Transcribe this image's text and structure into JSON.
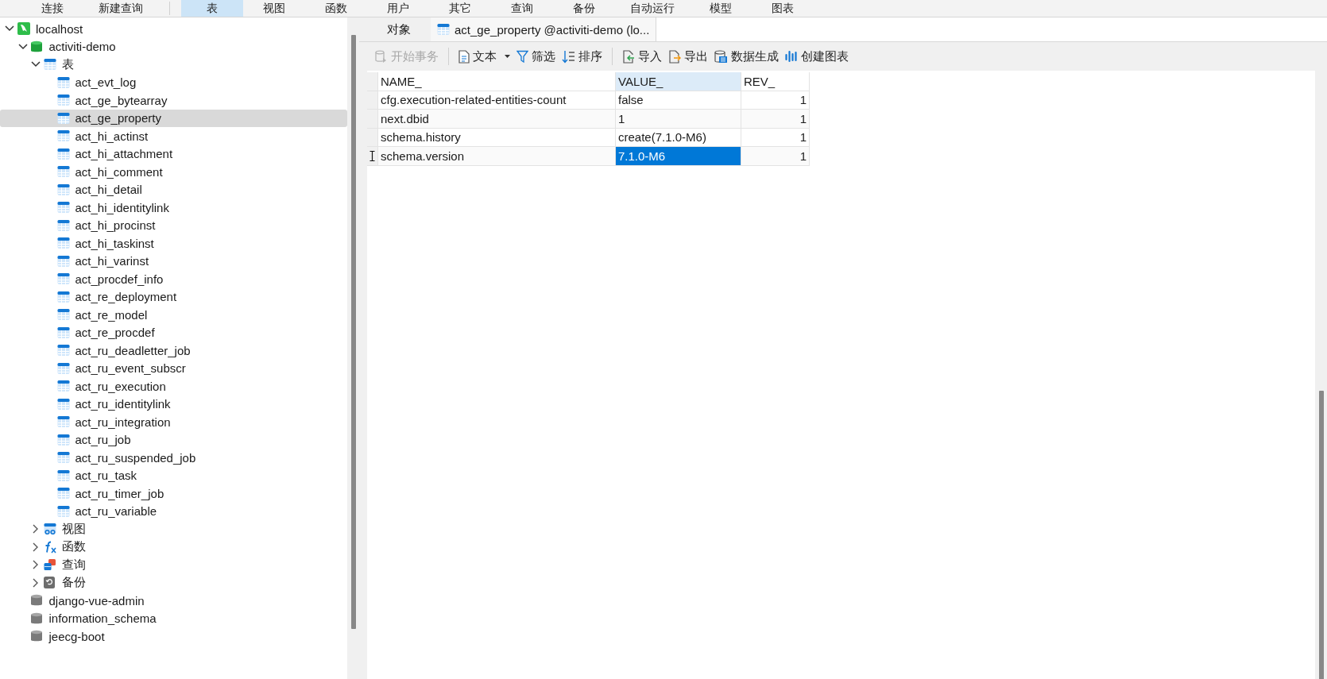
{
  "menubar": {
    "groups": [
      [
        {
          "label": "连接",
          "selected": false
        },
        {
          "label": "新建查询",
          "selected": false
        }
      ],
      [
        {
          "label": "表",
          "selected": true
        },
        {
          "label": "视图",
          "selected": false
        },
        {
          "label": "函数",
          "selected": false
        },
        {
          "label": "用户",
          "selected": false
        },
        {
          "label": "其它",
          "selected": false
        },
        {
          "label": "查询",
          "selected": false
        },
        {
          "label": "备份",
          "selected": false
        },
        {
          "label": "自动运行",
          "selected": false
        },
        {
          "label": "模型",
          "selected": false
        },
        {
          "label": "图表",
          "selected": false
        }
      ]
    ]
  },
  "navigator": {
    "items": [
      {
        "kind": "connection",
        "label": "localhost",
        "expanded": true,
        "selected": false,
        "children": [
          {
            "kind": "database",
            "label": "activiti-demo",
            "open": true,
            "expanded": true,
            "selected": false,
            "children": [
              {
                "kind": "tables",
                "label": "表",
                "expanded": true,
                "selected": false,
                "children": [
                  {
                    "kind": "table",
                    "label": "act_evt_log",
                    "selected": false
                  },
                  {
                    "kind": "table",
                    "label": "act_ge_bytearray",
                    "selected": false
                  },
                  {
                    "kind": "table",
                    "label": "act_ge_property",
                    "selected": true
                  },
                  {
                    "kind": "table",
                    "label": "act_hi_actinst",
                    "selected": false
                  },
                  {
                    "kind": "table",
                    "label": "act_hi_attachment",
                    "selected": false
                  },
                  {
                    "kind": "table",
                    "label": "act_hi_comment",
                    "selected": false
                  },
                  {
                    "kind": "table",
                    "label": "act_hi_detail",
                    "selected": false
                  },
                  {
                    "kind": "table",
                    "label": "act_hi_identitylink",
                    "selected": false
                  },
                  {
                    "kind": "table",
                    "label": "act_hi_procinst",
                    "selected": false
                  },
                  {
                    "kind": "table",
                    "label": "act_hi_taskinst",
                    "selected": false
                  },
                  {
                    "kind": "table",
                    "label": "act_hi_varinst",
                    "selected": false
                  },
                  {
                    "kind": "table",
                    "label": "act_procdef_info",
                    "selected": false
                  },
                  {
                    "kind": "table",
                    "label": "act_re_deployment",
                    "selected": false
                  },
                  {
                    "kind": "table",
                    "label": "act_re_model",
                    "selected": false
                  },
                  {
                    "kind": "table",
                    "label": "act_re_procdef",
                    "selected": false
                  },
                  {
                    "kind": "table",
                    "label": "act_ru_deadletter_job",
                    "selected": false
                  },
                  {
                    "kind": "table",
                    "label": "act_ru_event_subscr",
                    "selected": false
                  },
                  {
                    "kind": "table",
                    "label": "act_ru_execution",
                    "selected": false
                  },
                  {
                    "kind": "table",
                    "label": "act_ru_identitylink",
                    "selected": false
                  },
                  {
                    "kind": "table",
                    "label": "act_ru_integration",
                    "selected": false
                  },
                  {
                    "kind": "table",
                    "label": "act_ru_job",
                    "selected": false
                  },
                  {
                    "kind": "table",
                    "label": "act_ru_suspended_job",
                    "selected": false
                  },
                  {
                    "kind": "table",
                    "label": "act_ru_task",
                    "selected": false
                  },
                  {
                    "kind": "table",
                    "label": "act_ru_timer_job",
                    "selected": false
                  },
                  {
                    "kind": "table",
                    "label": "act_ru_variable",
                    "selected": false
                  }
                ]
              },
              {
                "kind": "views",
                "label": "视图",
                "expanded": false,
                "selected": false
              },
              {
                "kind": "functions",
                "label": "函数",
                "expanded": false,
                "selected": false
              },
              {
                "kind": "queries",
                "label": "查询",
                "expanded": false,
                "selected": false
              },
              {
                "kind": "backups",
                "label": "备份",
                "expanded": false,
                "selected": false
              }
            ]
          },
          {
            "kind": "database",
            "label": "django-vue-admin",
            "open": false,
            "selected": false
          },
          {
            "kind": "database",
            "label": "information_schema",
            "open": false,
            "selected": false
          },
          {
            "kind": "database",
            "label": "jeecg-boot",
            "open": false,
            "selected": false
          }
        ]
      }
    ]
  },
  "tabs": [
    {
      "kind": "objects",
      "label": "对象",
      "selected": false
    },
    {
      "kind": "table",
      "label": "act_ge_property @activiti-demo (lo...",
      "selected": true
    }
  ],
  "toolbar": {
    "groups": [
      [
        {
          "kind": "transaction",
          "label": "开始事务",
          "disabled": true,
          "dropdown": false
        }
      ],
      [
        {
          "kind": "text",
          "label": "文本",
          "disabled": false,
          "dropdown": true
        },
        {
          "kind": "filter",
          "label": "筛选",
          "disabled": false,
          "dropdown": false
        },
        {
          "kind": "sort",
          "label": "排序",
          "disabled": false,
          "dropdown": false
        }
      ],
      [
        {
          "kind": "import",
          "label": "导入",
          "disabled": false,
          "dropdown": false
        },
        {
          "kind": "export",
          "label": "导出",
          "disabled": false,
          "dropdown": false
        },
        {
          "kind": "generate",
          "label": "数据生成",
          "disabled": false,
          "dropdown": false
        },
        {
          "kind": "chart",
          "label": "创建图表",
          "disabled": false,
          "dropdown": false
        }
      ]
    ]
  },
  "table": {
    "columns": [
      {
        "label": "NAME_",
        "kind": "text",
        "selected": false
      },
      {
        "label": "VALUE_",
        "kind": "text",
        "selected": true
      },
      {
        "label": "REV_",
        "kind": "number",
        "selected": false
      }
    ],
    "rows": [
      {
        "current": false,
        "cells": [
          {
            "text": "cfg.execution-related-entities-count",
            "selected": false
          },
          {
            "text": "false",
            "selected": false
          },
          {
            "text": "1",
            "selected": false
          }
        ]
      },
      {
        "current": false,
        "cells": [
          {
            "text": "next.dbid",
            "selected": false
          },
          {
            "text": "1",
            "selected": false
          },
          {
            "text": "1",
            "selected": false
          }
        ]
      },
      {
        "current": false,
        "cells": [
          {
            "text": "schema.history",
            "selected": false
          },
          {
            "text": "create(7.1.0-M6)",
            "selected": false
          },
          {
            "text": "1",
            "selected": false
          }
        ]
      },
      {
        "current": true,
        "cells": [
          {
            "text": "schema.version",
            "selected": false
          },
          {
            "text": "7.1.0-M6",
            "selected": true
          },
          {
            "text": "1",
            "selected": false
          }
        ]
      }
    ]
  }
}
